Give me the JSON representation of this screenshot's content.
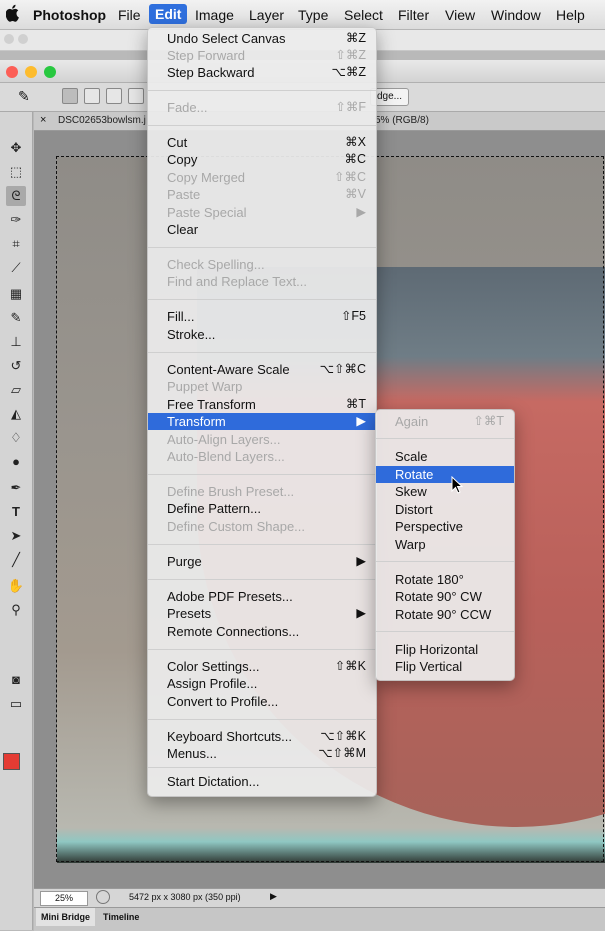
{
  "menubar": {
    "items": [
      "Photoshop",
      "File",
      "Edit",
      "Image",
      "Layer",
      "Type",
      "Select",
      "Filter",
      "View",
      "Window",
      "Help"
    ],
    "active": "Edit"
  },
  "options_bar": {
    "refine_edge_label": "dge..."
  },
  "document": {
    "tab_title": "DSC02653bowlsm.j",
    "tab_mode": "5% (RGB/8)",
    "zoom": "25%",
    "doc_info": "5472 px x 3080 px (350 ppi)"
  },
  "bottom_tabs": [
    "Mini Bridge",
    "Timeline"
  ],
  "colors": {
    "foreground": "#e43b33",
    "background": "#ffffff",
    "highlight": "#2f6bdb"
  },
  "icons": [
    "apple-icon",
    "move-tool-icon",
    "marquee-tool-icon",
    "lasso-tool-icon",
    "quick-select-icon",
    "crop-icon",
    "eyedropper-icon",
    "spot-heal-icon",
    "brush-icon",
    "stamp-icon",
    "history-brush-icon",
    "eraser-icon",
    "bucket-icon",
    "blur-icon",
    "dodge-icon",
    "pen-icon",
    "type-icon",
    "path-select-icon",
    "line-icon",
    "hand-icon",
    "zoom-icon",
    "quickmask-icon",
    "screen-mode-icon"
  ],
  "edit_menu": {
    "items": [
      {
        "label": "Undo Select Canvas",
        "shortcut": "⌘Z",
        "disabled": false
      },
      {
        "label": "Step Forward",
        "shortcut": "⇧⌘Z",
        "disabled": true
      },
      {
        "label": "Step Backward",
        "shortcut": "⌥⌘Z",
        "disabled": false
      },
      {
        "label": "Fade...",
        "shortcut": "⇧⌘F",
        "disabled": true
      },
      {
        "label": "Cut",
        "shortcut": "⌘X",
        "disabled": false
      },
      {
        "label": "Copy",
        "shortcut": "⌘C",
        "disabled": false
      },
      {
        "label": "Copy Merged",
        "shortcut": "⇧⌘C",
        "disabled": true
      },
      {
        "label": "Paste",
        "shortcut": "⌘V",
        "disabled": true
      },
      {
        "label": "Paste Special",
        "shortcut": "▶",
        "disabled": true
      },
      {
        "label": "Clear",
        "shortcut": "",
        "disabled": false
      },
      {
        "label": "Check Spelling...",
        "shortcut": "",
        "disabled": true
      },
      {
        "label": "Find and Replace Text...",
        "shortcut": "",
        "disabled": true
      },
      {
        "label": "Fill...",
        "shortcut": "⇧F5",
        "disabled": false
      },
      {
        "label": "Stroke...",
        "shortcut": "",
        "disabled": false
      },
      {
        "label": "Content-Aware Scale",
        "shortcut": "⌥⇧⌘C",
        "disabled": false
      },
      {
        "label": "Puppet Warp",
        "shortcut": "",
        "disabled": true
      },
      {
        "label": "Free Transform",
        "shortcut": "⌘T",
        "disabled": false
      },
      {
        "label": "Transform",
        "shortcut": "▶",
        "disabled": false,
        "highlighted": true
      },
      {
        "label": "Auto-Align Layers...",
        "shortcut": "",
        "disabled": true
      },
      {
        "label": "Auto-Blend Layers...",
        "shortcut": "",
        "disabled": true
      },
      {
        "label": "Define Brush Preset...",
        "shortcut": "",
        "disabled": true
      },
      {
        "label": "Define Pattern...",
        "shortcut": "",
        "disabled": false
      },
      {
        "label": "Define Custom Shape...",
        "shortcut": "",
        "disabled": true
      },
      {
        "label": "Purge",
        "shortcut": "▶",
        "disabled": false
      },
      {
        "label": "Adobe PDF Presets...",
        "shortcut": "",
        "disabled": false
      },
      {
        "label": "Presets",
        "shortcut": "▶",
        "disabled": false
      },
      {
        "label": "Remote Connections...",
        "shortcut": "",
        "disabled": false
      },
      {
        "label": "Color Settings...",
        "shortcut": "⇧⌘K",
        "disabled": false
      },
      {
        "label": "Assign Profile...",
        "shortcut": "",
        "disabled": false
      },
      {
        "label": "Convert to Profile...",
        "shortcut": "",
        "disabled": false
      },
      {
        "label": "Keyboard Shortcuts...",
        "shortcut": "⌥⇧⌘K",
        "disabled": false
      },
      {
        "label": "Menus...",
        "shortcut": "⌥⇧⌘M",
        "disabled": false
      },
      {
        "label": "Start Dictation...",
        "shortcut": "",
        "disabled": false
      }
    ]
  },
  "transform_menu": {
    "items": [
      {
        "label": "Again",
        "shortcut": "⇧⌘T",
        "disabled": true
      },
      {
        "label": "Scale",
        "shortcut": "",
        "disabled": false
      },
      {
        "label": "Rotate",
        "shortcut": "",
        "disabled": false,
        "highlighted": true
      },
      {
        "label": "Skew",
        "shortcut": "",
        "disabled": false
      },
      {
        "label": "Distort",
        "shortcut": "",
        "disabled": false
      },
      {
        "label": "Perspective",
        "shortcut": "",
        "disabled": false
      },
      {
        "label": "Warp",
        "shortcut": "",
        "disabled": false
      },
      {
        "label": "Rotate 180°",
        "shortcut": "",
        "disabled": false
      },
      {
        "label": "Rotate 90° CW",
        "shortcut": "",
        "disabled": false
      },
      {
        "label": "Rotate 90° CCW",
        "shortcut": "",
        "disabled": false
      },
      {
        "label": "Flip Horizontal",
        "shortcut": "",
        "disabled": false
      },
      {
        "label": "Flip Vertical",
        "shortcut": "",
        "disabled": false
      }
    ]
  }
}
